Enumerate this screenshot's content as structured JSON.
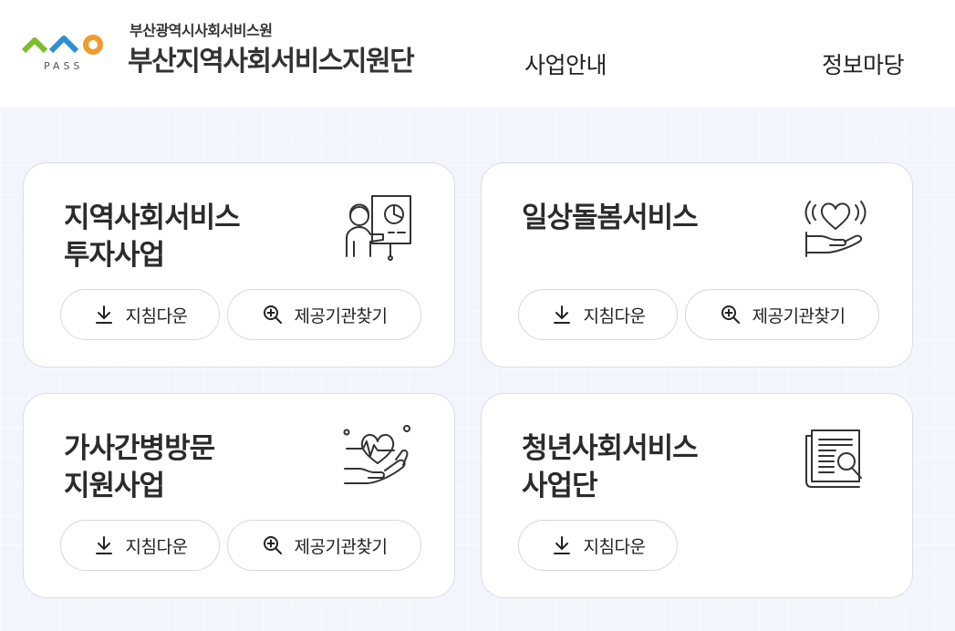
{
  "header": {
    "logo_text": "PASS",
    "org_sub": "부산광역시사회서비스원",
    "org_main": "부산지역사회서비스지원단",
    "nav": [
      "사업안내",
      "정보마당"
    ]
  },
  "colors": {
    "logo_green": "#7cbd2a",
    "logo_blue": "#2e8fd6",
    "logo_orange": "#f29a2e"
  },
  "cards": [
    {
      "title_lines": [
        "지역사회서비스",
        "투자사업"
      ],
      "icon": "presentation-icon",
      "download_label": "지침다운",
      "find_label": "제공기관찾기"
    },
    {
      "title_lines": [
        "일상돌봄서비스"
      ],
      "icon": "hand-heart-icon",
      "download_label": "지침다운",
      "find_label": "제공기관찾기"
    },
    {
      "title_lines": [
        "가사간병방문",
        "지원사업"
      ],
      "icon": "heartbeat-hand-icon",
      "download_label": "지침다운",
      "find_label": "제공기관찾기"
    },
    {
      "title_lines": [
        "청년사회서비스",
        "사업단"
      ],
      "icon": "document-search-icon",
      "download_label": "지침다운"
    }
  ]
}
